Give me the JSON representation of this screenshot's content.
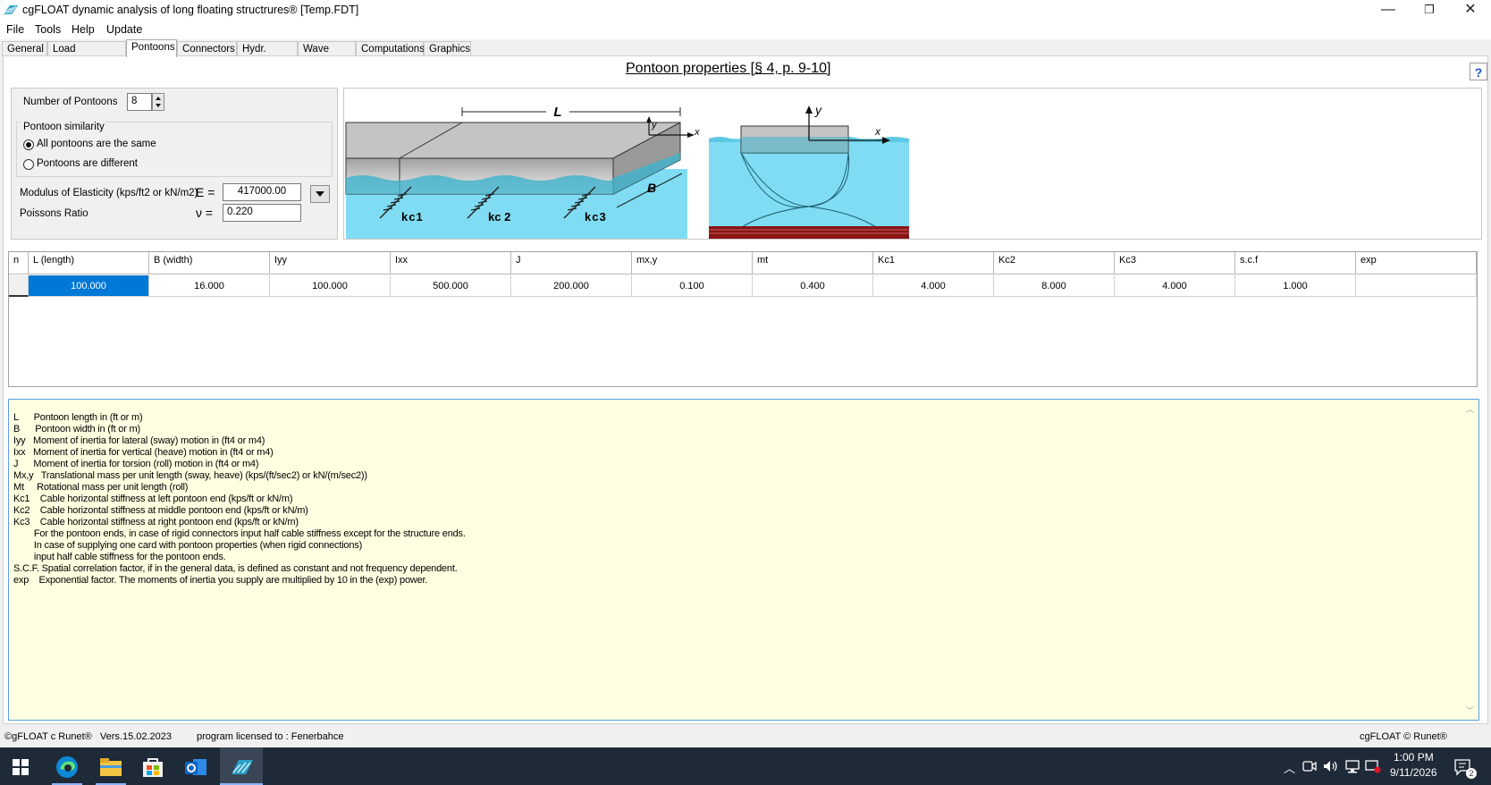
{
  "window": {
    "title": "cgFLOAT dynamic analysis of long floating structrures®  [Temp.FDT]",
    "minimize": "—",
    "restore": "❐",
    "close": "✕"
  },
  "menu": [
    "File",
    "Tools",
    "Help",
    "Update"
  ],
  "tabs": [
    "General",
    "Load correlation",
    "Pontoons",
    "Connectors",
    "Hydr. Coeff.",
    "Wave data",
    "Computations",
    "Graphics"
  ],
  "page": {
    "heading": "Pontoon properties [§ 4,  p. 9-10]",
    "help": "?"
  },
  "form": {
    "num_pontoons_label": "Number of Pontoons",
    "num_pontoons_value": "8",
    "similarity_group": "Pontoon similarity",
    "opt_same": "All pontoons are the same",
    "opt_diff": "Pontoons are different",
    "modulus_label": "Modulus of Elasticity (kps/ft2 or kN/m2)",
    "modulus_symbol": "E =",
    "modulus_value": "417000.00",
    "poisson_label": "Poissons Ratio",
    "poisson_symbol": "ν =",
    "poisson_value": "0.220"
  },
  "diagram": {
    "L": "L",
    "B": "B",
    "x": "x",
    "y": "y",
    "kc1": "kc1",
    "kc2": "kc 2",
    "kc3": "kc3",
    "water_color": "#7fdcf2",
    "deck_color": "#c4c4c4"
  },
  "table": {
    "row_header": "n",
    "columns": [
      "L (length)",
      "B (width)",
      "Iyy",
      "Ixx",
      "J",
      "mx,y",
      "mt",
      "Kc1",
      "Kc2",
      "Kc3",
      "s.c.f",
      "exp"
    ],
    "rows": [
      [
        "100.000",
        "16.000",
        "100.000",
        "500.000",
        "200.000",
        "0.100",
        "0.400",
        "4.000",
        "8.000",
        "4.000",
        "1.000",
        ""
      ]
    ],
    "selection_color": "#0078d7"
  },
  "legend": [
    "L      Pontoon length in (ft or m)",
    "B      Pontoon width in (ft or m)",
    "Iyy   Moment of inertia for lateral (sway) motion in (ft4 or m4)",
    "Ixx   Moment of inertia for vertical (heave) motion in (ft4 or m4)",
    "J      Moment of inertia for torsion (roll) motion in (ft4 or m4)",
    "Mx,y   Translational mass per unit length (sway, heave) (kps/(ft/sec2) or kN/(m/sec2))",
    "Mt     Rotational mass per unit length (roll)",
    "Kc1    Cable horizontal stiffness at left pontoon end (kps/ft or kN/m)",
    "Kc2    Cable horizontal stiffness at middle pontoon end (kps/ft or kN/m)",
    "Kc3    Cable horizontal stiffness at right pontoon end (kps/ft or kN/m)",
    "        For the pontoon ends, in case of rigid connectors input half cable stiffness except for the structure ends.",
    "        In case of supplying one card with pontoon properties (when rigid connections)",
    "        input half cable stiffness for the pontoon ends.",
    "S.C.F. Spatial correlation factor, if in the general data, is defined as constant and not frequency dependent.",
    "exp    Exponential factor. The moments of inertia you supply are multiplied by 10 in the (exp) power."
  ],
  "status": {
    "left": "©gFLOAT c Runet®   Vers.15.02.2023",
    "license": "program licensed to : Fenerbahce",
    "right": "cgFLOAT © Runet®"
  },
  "taskbar": {
    "time": "1:00 PM",
    "date": "9/11/2026",
    "notifications": "2",
    "icons": [
      "windows-start-icon",
      "edge-icon",
      "file-explorer-icon",
      "store-icon",
      "outlook-icon",
      "cgfloat-icon"
    ]
  }
}
